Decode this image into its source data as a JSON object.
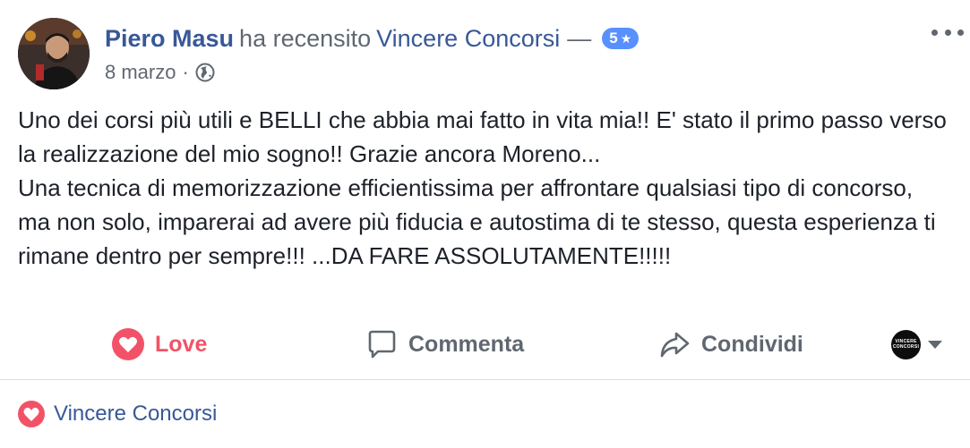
{
  "header": {
    "author": "Piero Masu",
    "verb": "ha recensito",
    "page": "Vincere Concorsi",
    "dash": "—",
    "rating": "5",
    "date": "8 marzo",
    "separator": "·"
  },
  "post": {
    "lines": [
      "Uno dei corsi più utili e BELLI che abbia mai fatto in vita mia!! E' stato il primo passo verso la realizzazione del mio sogno!! Grazie ancora Moreno...",
      "Una tecnica di memorizzazione efficientissima per affrontare qualsiasi tipo di concorso, ma non solo, imparerai ad avere più fiducia e autostima di te stesso, questa esperienza ti rimane dentro per sempre!!! ...DA FARE ASSOLUTAMENTE!!!!!"
    ]
  },
  "actions": {
    "love": "Love",
    "comment": "Commenta",
    "share": "Condividi",
    "page_avatar_text": "VINCERE CONCORSI"
  },
  "reactions": {
    "name": "Vincere Concorsi"
  },
  "colors": {
    "link": "#385898",
    "love": "#f25268",
    "badge": "#5890ff",
    "muted": "#606770"
  },
  "icons": [
    "globe-icon",
    "more-icon",
    "heart-icon",
    "comment-icon",
    "share-icon",
    "caret-down-icon"
  ]
}
